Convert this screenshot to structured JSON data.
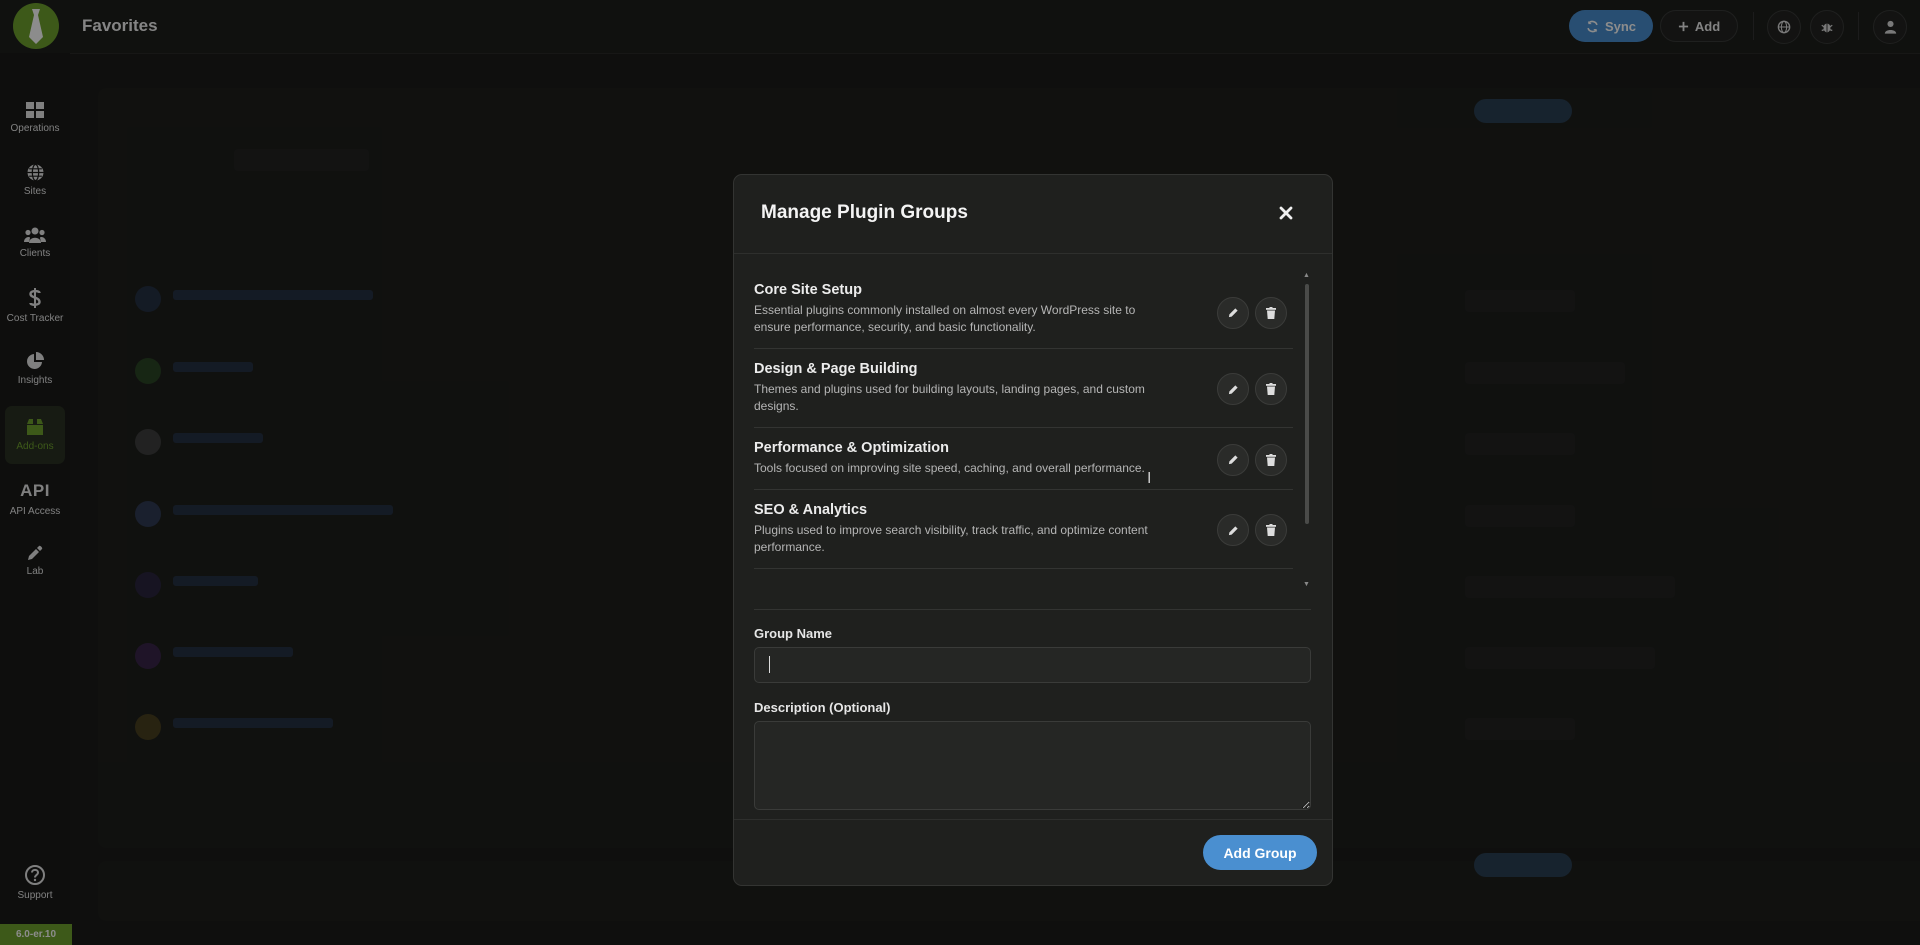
{
  "app": {
    "page_title": "Favorites",
    "version": "6.0-er.10"
  },
  "header": {
    "sync_label": "Sync",
    "add_label": "Add"
  },
  "sidebar": {
    "items": [
      {
        "label": "Operations",
        "icon": "grid-icon"
      },
      {
        "label": "Sites",
        "icon": "globe-icon"
      },
      {
        "label": "Clients",
        "icon": "users-icon"
      },
      {
        "label": "Cost Tracker",
        "icon": "dollar-icon"
      },
      {
        "label": "Insights",
        "icon": "pie-chart-icon"
      },
      {
        "label": "Add-ons",
        "icon": "box-icon",
        "active": true
      },
      {
        "label": "API Access",
        "icon_text": "API"
      },
      {
        "label": "Lab",
        "icon": "eyedropper-icon"
      }
    ],
    "support_label": "Support"
  },
  "modal": {
    "title": "Manage Plugin Groups",
    "groups": [
      {
        "name": "Core Site Setup",
        "description": "Essential plugins commonly installed on almost every WordPress site to ensure performance, security, and basic functionality."
      },
      {
        "name": "Design & Page Building",
        "description": "Themes and plugins used for building layouts, landing pages, and custom designs."
      },
      {
        "name": "Performance & Optimization",
        "description": "Tools focused on improving site speed, caching, and overall performance."
      },
      {
        "name": "SEO & Analytics",
        "description": "Plugins used to improve search visibility, track traffic, and optimize content performance."
      }
    ],
    "form": {
      "group_name_label": "Group Name",
      "group_name_value": "",
      "description_label": "Description (Optional)",
      "description_value": ""
    },
    "add_group_label": "Add Group"
  },
  "colors": {
    "accent_green": "#6fa32e",
    "primary_blue": "#4a8fd0",
    "background": "#1c1d1b"
  }
}
